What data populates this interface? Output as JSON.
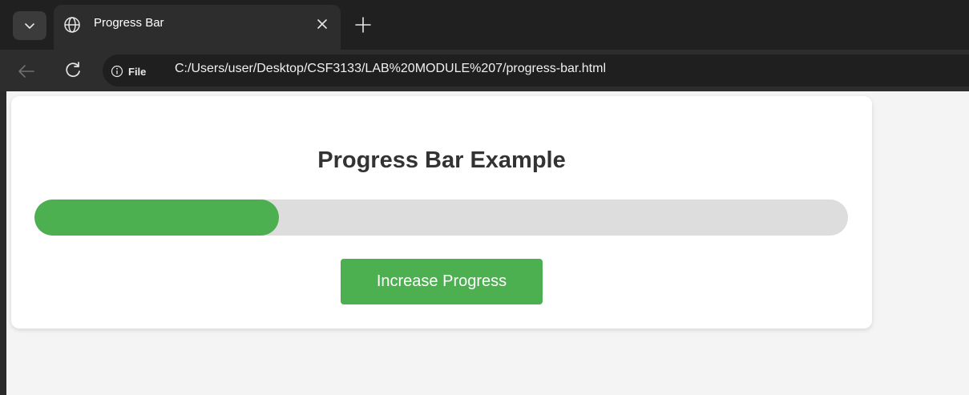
{
  "browser": {
    "tab": {
      "title": "Progress Bar",
      "icon": "globe-icon"
    },
    "toolbar": {
      "site_info_label": "File",
      "url": "C:/Users/user/Desktop/CSF3133/LAB%20MODULE%207/progress-bar.html"
    }
  },
  "page": {
    "title": "Progress Bar Example",
    "progress": {
      "fraction": 0.3
    },
    "button_label": "Increase Progress"
  },
  "colors": {
    "accent": "#4caf50",
    "track": "#dddddd",
    "title": "#333333"
  }
}
